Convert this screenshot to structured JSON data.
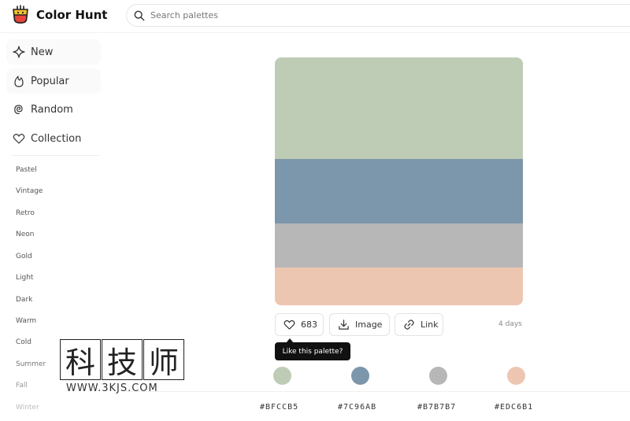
{
  "header": {
    "app_name": "Color Hunt",
    "search_placeholder": "Search palettes"
  },
  "sidebar": {
    "nav": [
      {
        "label": "New",
        "icon": "sparkle-icon"
      },
      {
        "label": "Popular",
        "icon": "flame-icon"
      },
      {
        "label": "Random",
        "icon": "spiral-icon"
      },
      {
        "label": "Collection",
        "icon": "heart-icon"
      }
    ],
    "tags": [
      "Pastel",
      "Vintage",
      "Retro",
      "Neon",
      "Gold",
      "Light",
      "Dark",
      "Warm",
      "Cold",
      "Summer",
      "Fall",
      "Winter"
    ]
  },
  "palette": {
    "colors": [
      "#BFCCB5",
      "#7C96AB",
      "#B7B7B7",
      "#EDC6B1"
    ],
    "likes": "683",
    "image_label": "Image",
    "link_label": "Link",
    "age": "4 days",
    "tooltip": "Like this palette?"
  },
  "watermark": {
    "chars": [
      "科",
      "技",
      "师"
    ],
    "url": "WWW.3KJS.COM"
  },
  "colors": {
    "logo_yellow": "#F2C230",
    "logo_red": "#E8453C",
    "tag_fade_end": "#BBBBBB"
  }
}
